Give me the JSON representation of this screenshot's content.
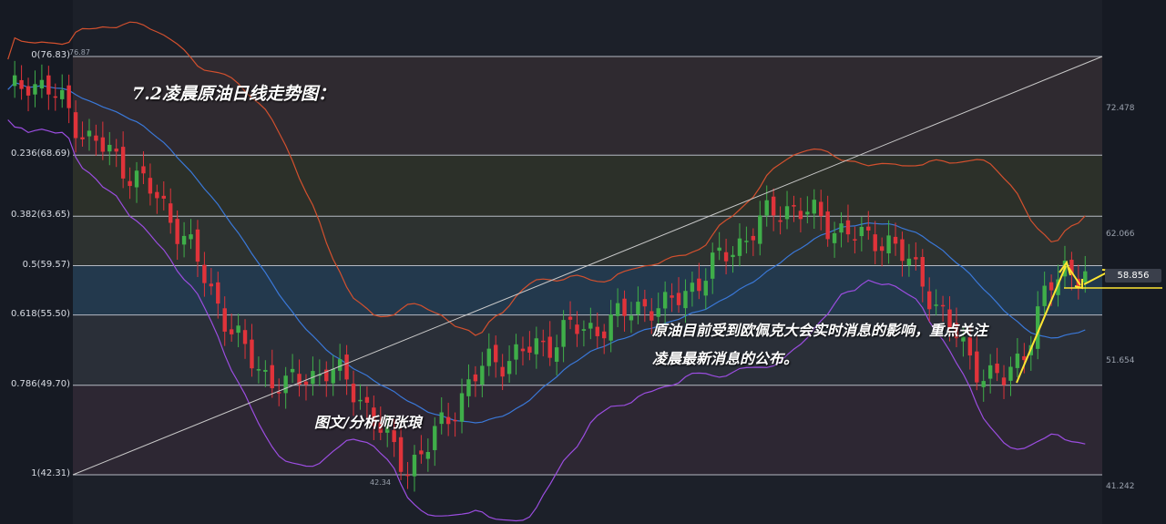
{
  "chart_data": {
    "type": "candlestick",
    "fib_levels": [
      {
        "label": "0(76.83)",
        "price": 76.83
      },
      {
        "label": "0.236(68.69)",
        "price": 68.69
      },
      {
        "label": "0.382(63.65)",
        "price": 63.65
      },
      {
        "label": "0.5(59.57)",
        "price": 59.57
      },
      {
        "label": "0.618(55.50)",
        "price": 55.5
      },
      {
        "label": "0.786(49.70)",
        "price": 49.7
      },
      {
        "label": "1(42.31)",
        "price": 42.31
      }
    ],
    "price_ticks": [
      "72.478",
      "62.066",
      "51.654",
      "41.242"
    ],
    "current_price": "58.856",
    "high_label": "76.87",
    "low_label": "42.34",
    "indicator": "bollinger",
    "colors": {
      "up": "#3fae49",
      "down": "#e0333a",
      "upper_band": "#d2502e",
      "middle_band": "#3a78d8",
      "lower_band": "#9b4de0",
      "trend_line": "#c9c9c9",
      "annotation_arrow": "#ffe633"
    },
    "candle_closes_approx": [
      73.5,
      75.0,
      74.0,
      72.5,
      70.0,
      69.0,
      67.5,
      66.0,
      64.0,
      61.5,
      58.0,
      55.0,
      52.0,
      50.5,
      49.5,
      50.5,
      51.0,
      50.0,
      48.0,
      45.0,
      43.0,
      44.5,
      47.0,
      49.5,
      51.5,
      52.0,
      52.5,
      53.0,
      54.5,
      54.0,
      55.0,
      55.5,
      56.5,
      56.0,
      57.5,
      59.0,
      60.5,
      62.0,
      63.5,
      64.5,
      64.0,
      63.0,
      62.5,
      61.5,
      62.0,
      60.0,
      58.0,
      55.0,
      52.5,
      50.5,
      50.0,
      53.0,
      57.0,
      59.5,
      58.9
    ]
  },
  "annotations": {
    "title": "7.2凌晨原油日线走势图：",
    "author": "图文/分析师张琅",
    "commentary": "原油目前受到欧佩克大会实时消息的影响，重点关注凌晨最新消息的公布。"
  }
}
